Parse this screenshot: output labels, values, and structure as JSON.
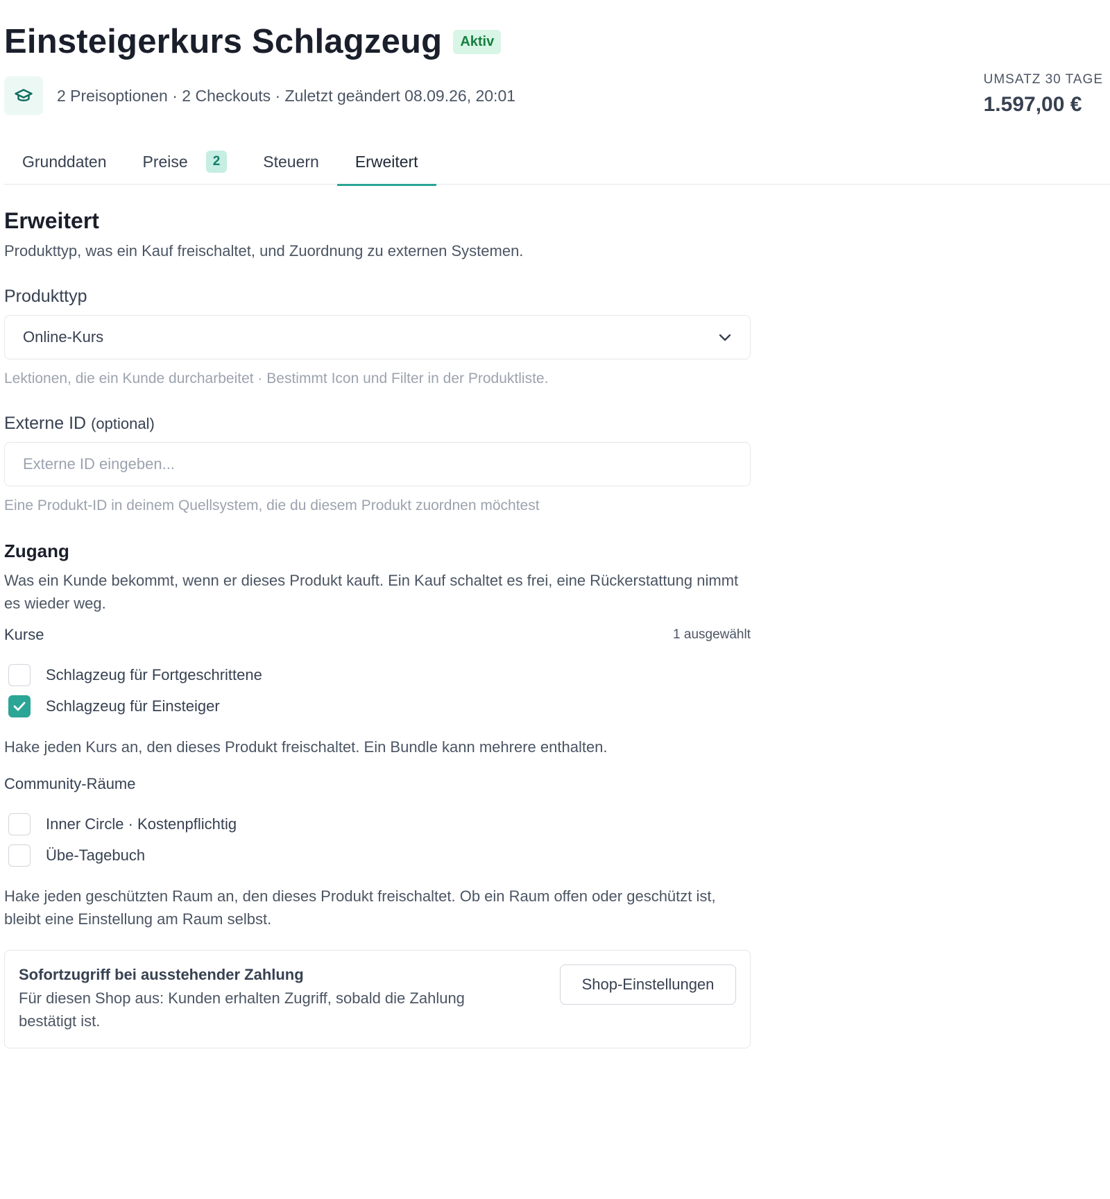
{
  "header": {
    "title": "Einsteigerkurs Schlagzeug",
    "status_badge": "Aktiv",
    "meta": "2 Preisoptionen · 2 Checkouts · Zuletzt geändert 08.09.26, 20:01",
    "product_icon": "graduation-cap-icon",
    "revenue_label": "UMSATZ 30 TAGE",
    "revenue_value": "1.597,00 €"
  },
  "tabs": [
    {
      "label": "Grunddaten",
      "active": false
    },
    {
      "label": "Preise",
      "count": "2",
      "active": false
    },
    {
      "label": "Steuern",
      "active": false
    },
    {
      "label": "Erweitert",
      "active": true
    }
  ],
  "section": {
    "title": "Erweitert",
    "description": "Produkttyp, was ein Kauf freischaltet, und Zuordnung zu externen Systemen."
  },
  "product_type": {
    "label": "Produkttyp",
    "value": "Online-Kurs",
    "help": "Lektionen, die ein Kunde durcharbeitet · Bestimmt Icon und Filter in der Produktliste."
  },
  "external_id": {
    "label": "Externe ID",
    "optional": "(optional)",
    "placeholder": "Externe ID eingeben...",
    "help": "Eine Produkt-ID in deinem Quellsystem, die du diesem Produkt zuordnen möchtest"
  },
  "access": {
    "title": "Zugang",
    "description": "Was ein Kunde bekommt, wenn er dieses Produkt kauft. Ein Kauf schaltet es frei, eine Rückerstattung nimmt es wieder weg.",
    "courses": {
      "label": "Kurse",
      "selected_count": "1 ausgewählt",
      "items": [
        {
          "label": "Schlagzeug für Fortgeschrittene",
          "checked": false
        },
        {
          "label": "Schlagzeug für Einsteiger",
          "checked": true
        }
      ],
      "help": "Hake jeden Kurs an, den dieses Produkt freischaltet. Ein Bundle kann mehrere enthalten."
    },
    "rooms": {
      "label": "Community-Räume",
      "items": [
        {
          "label": "Inner Circle · Kostenpflichtig",
          "checked": false
        },
        {
          "label": "Übe-Tagebuch",
          "checked": false
        }
      ],
      "help": "Hake jeden geschützten Raum an, den dieses Produkt freischaltet. Ob ein Raum offen oder geschützt ist, bleibt eine Einstellung am Raum selbst."
    }
  },
  "instant_access": {
    "title": "Sofortzugriff bei ausstehender Zahlung",
    "text": "Für diesen Shop aus: Kunden erhalten Zugriff, sobald die Zahlung bestätigt ist.",
    "button": "Shop-Einstellungen"
  },
  "colors": {
    "accent": "#2aa596",
    "badge_bg": "#d8f5e6",
    "badge_text": "#16803f"
  }
}
